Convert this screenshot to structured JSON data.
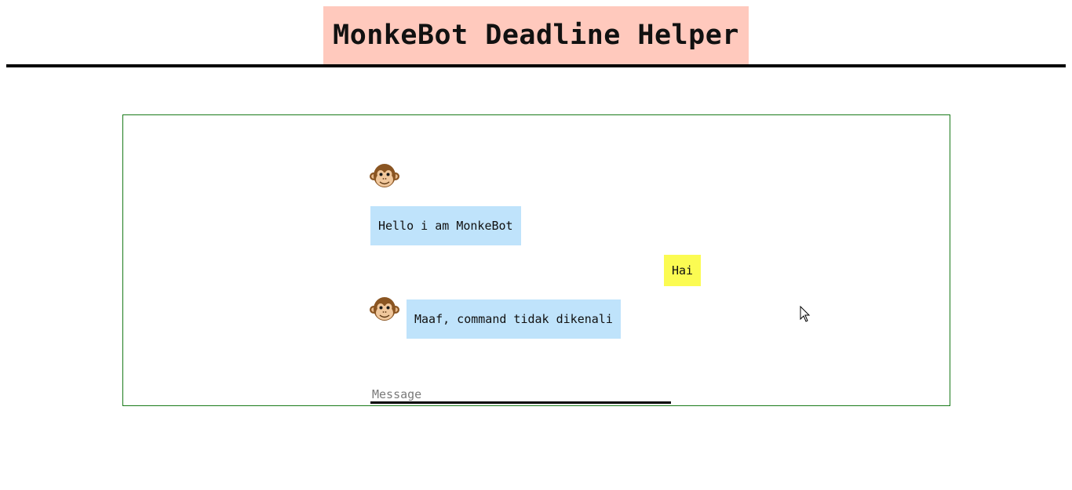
{
  "header": {
    "title": "MonkeBot Deadline Helper",
    "title_bg": "#ffc9bd"
  },
  "chat": {
    "border_color": "#1a7a1a",
    "bot_bubble_color": "#bfe3fb",
    "user_bubble_color": "#fbfb52",
    "messages": [
      {
        "sender": "bot",
        "avatar_icon": "monkey-face-icon",
        "text": "Hello i am MonkeBot"
      },
      {
        "sender": "user",
        "text": "Hai"
      },
      {
        "sender": "bot",
        "avatar_icon": "monkey-face-icon",
        "text": "Maaf, command tidak dikenali"
      }
    ]
  },
  "composer": {
    "placeholder": "Message",
    "value": ""
  },
  "pointer_icon": "mouse-pointer-icon"
}
